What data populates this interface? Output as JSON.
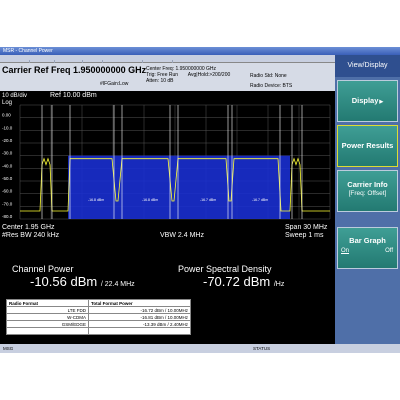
{
  "window": {
    "title": "MSR - Channel Power"
  },
  "header": {
    "title": "Carrier Ref Freq 1.950000000 GHz",
    "gain": "#IFGain:Low",
    "center_freq": "Center Freq: 1.950000000 GHz",
    "trig": "Trig: Free Run",
    "avg_hold": "Avg|Hold:>200/200",
    "atten": "Atten: 10 dB",
    "radio_std": "Radio Std: None",
    "radio_device": "Radio Device: BTS"
  },
  "graph": {
    "scale": "10 dB/div",
    "ref": "Ref 10.00 dBm",
    "log": "Log",
    "y_ticks": [
      "0.00",
      "-10.0",
      "-20.0",
      "-30.0",
      "-40.0",
      "-50.0",
      "-60.0",
      "-70.0",
      "-80.0"
    ],
    "carrier_labels": [
      "-16.8 dBm",
      "-16.8 dBm",
      "-16.7 dBm",
      "-16.7 dBm",
      "-16.8 dBm"
    ],
    "center": "Center 1.95 GHz",
    "res_bw": "#Res BW 240 kHz",
    "vbw": "VBW 2.4 MHz",
    "span": "Span 30 MHz",
    "sweep": "Sweep 1 ms"
  },
  "results": {
    "channel_power_label": "Channel Power",
    "channel_power_value": "-10.56 dBm",
    "channel_power_bw": "/ 22.4 MHz",
    "psd_label": "Power Spectral Density",
    "psd_value": "-70.72 dBm",
    "psd_unit": "/Hz",
    "table_headers": [
      "Radio Format",
      "Total Format Power"
    ],
    "table_rows": [
      {
        "format": "LTE FDD",
        "power": "-16.72 dBm / 10.00MHz"
      },
      {
        "format": "W-CDMA",
        "power": "-16.81 dBm / 10.00MHz"
      },
      {
        "format": "GSM/EDGE",
        "power": "-13.39 dBm / 2.40MHz"
      },
      {
        "format": "",
        "power": ""
      }
    ]
  },
  "status": {
    "left": "MSG",
    "right": "STATUS"
  },
  "softkeys": {
    "title": "View/Display",
    "display": "Display",
    "power_results": "Power Results",
    "carrier_info": "Carrier Info",
    "carrier_info_sub": "[Freq: Offset]",
    "bar_graph": "Bar Graph",
    "bar_on": "On",
    "bar_off": "Off"
  },
  "colors": {
    "trace": "#ffff33",
    "fill": "#1a2fd0",
    "grid": "#555555",
    "softkey": "#237a72"
  }
}
